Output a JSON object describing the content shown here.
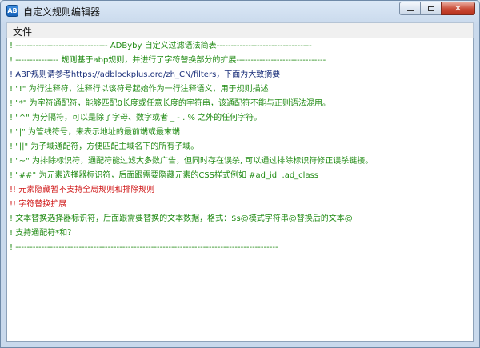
{
  "window": {
    "title": "自定义规则编辑器",
    "app_icon_text": "AB",
    "buttons": {
      "minimize": "minimize-icon",
      "maximize": "maximize-icon",
      "close": "✕"
    }
  },
  "menu": {
    "file": "文件"
  },
  "colors": {
    "comment": "#1f8a12",
    "warning": "#d01818",
    "text": "#1a2f7a"
  },
  "editor": {
    "lines": [
      "! -------------------------------- ADByby 自定义过滤语法简表---------------------------------",
      "! --------------- 规则基于abp规则，并进行了字符替换部分的扩展-------------------------------",
      "! ABP规则请参考https://adblockplus.org/zh_CN/filters，下面为大致摘要",
      "! \"!\" 为行注释符，注释行以该符号起始作为一行注释语义，用于规则描述",
      "! \"*\" 为字符通配符，能够匹配0长度或任意长度的字符串，该通配符不能与正则语法混用。",
      "! \"^\" 为分隔符，可以是除了字母、数字或者 _ - . % 之外的任何字符。",
      "! \"|\" 为管线符号，来表示地址的最前端或最末端",
      "! \"||\" 为子域通配符，方便匹配主域名下的所有子域。",
      "! \"~\" 为排除标识符，通配符能过滤大多数广告，但同时存在误杀, 可以通过排除标识符修正误杀链接。",
      "! \"##\" 为元素选择器标识符，后面跟需要隐藏元素的CSS样式例如 #ad_id  .ad_class",
      "!! 元素隐藏暂不支持全局规则和排除规则",
      "!! 字符替换扩展",
      "! 文本替换选择器标识符，后面跟需要替换的文本数据，格式：$s@模式字符串@替换后的文本@",
      "! 支持通配符*和？",
      "! -------------------------------------------------------------------------------------------"
    ]
  }
}
